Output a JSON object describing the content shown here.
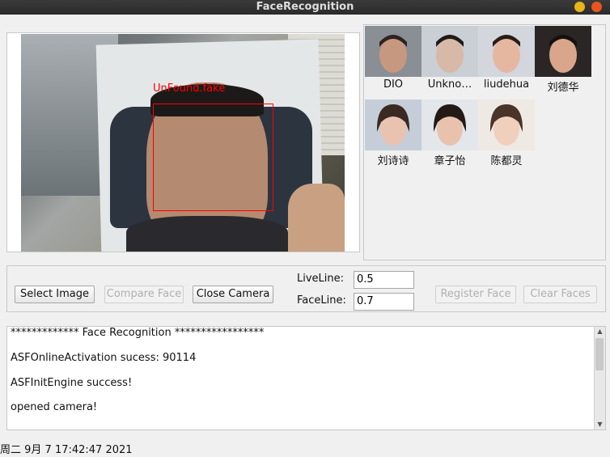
{
  "window": {
    "title": "FaceRecognition"
  },
  "video": {
    "detection_label": "UnFound.fake"
  },
  "faces": [
    {
      "name": "DIO",
      "skin": "#c79880",
      "hair": "#2b2420",
      "bg": "#8a8f95"
    },
    {
      "name": "Unkno…",
      "skin": "#d8b8a6",
      "hair": "#1e1a18",
      "bg": "#c9cfd4"
    },
    {
      "name": "liudehua",
      "skin": "#e6b7a0",
      "hair": "#2a1d17",
      "bg": "#d3d6dc"
    },
    {
      "name": "刘德华",
      "skin": "#d9a68b",
      "hair": "#15110f",
      "bg": "#2a2626"
    },
    {
      "name": "刘诗诗",
      "skin": "#e9c3b0",
      "hair": "#3a2a22",
      "bg": "#c5ced8"
    },
    {
      "name": "章子怡",
      "skin": "#e8c2ad",
      "hair": "#231a16",
      "bg": "#e3e6ea"
    },
    {
      "name": "陈都灵",
      "skin": "#f1cfbd",
      "hair": "#4a3328",
      "bg": "#efe9e4"
    }
  ],
  "controls": {
    "select_image": "Select Image",
    "compare_face": "Compare Face",
    "close_camera": "Close Camera",
    "liveline_label": "LiveLine:",
    "liveline_value": "0.5",
    "faceline_label": "FaceLine:",
    "faceline_value": "0.7",
    "register_face": "Register Face",
    "clear_faces": "Clear Faces"
  },
  "log": [
    "************* Face Recognition *****************",
    "ASFOnlineActivation sucess: 90114",
    "ASFInitEngine success!",
    "opened camera!"
  ],
  "status": "周二 9月 7 17:42:47 2021"
}
